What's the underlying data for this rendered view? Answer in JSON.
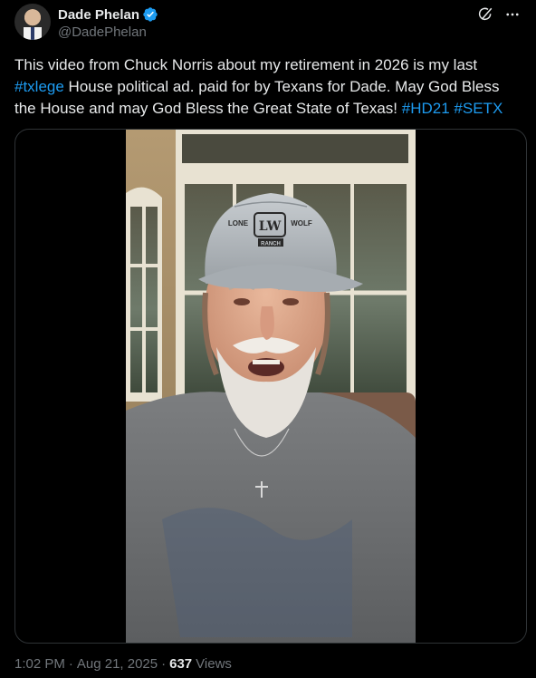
{
  "author": {
    "display_name": "Dade Phelan",
    "handle": "@DadePhelan",
    "verified_color": "#1d9bf0"
  },
  "actions": {
    "grok_icon": "grok-icon",
    "more_icon": "more-icon"
  },
  "tweet": {
    "segments": [
      {
        "text": "This video from Chuck Norris about my retirement in 2026 is my last ",
        "type": "text"
      },
      {
        "text": "#txlege",
        "type": "hashtag"
      },
      {
        "text": " House political ad. paid for by Texans for Dade. May God Bless the House and may God Bless the Great State of Texas! ",
        "type": "text"
      },
      {
        "text": "#HD21",
        "type": "hashtag"
      },
      {
        "text": " ",
        "type": "text"
      },
      {
        "text": "#SETX",
        "type": "hashtag"
      }
    ]
  },
  "video": {
    "cap_text_top": "LONE",
    "cap_text_right": "WOLF",
    "cap_text_bottom": "RANCH",
    "cap_logo": "LW"
  },
  "footer": {
    "time": "1:02 PM",
    "separator": "·",
    "date": "Aug 21, 2025",
    "views_count": "637",
    "views_label": "Views"
  }
}
